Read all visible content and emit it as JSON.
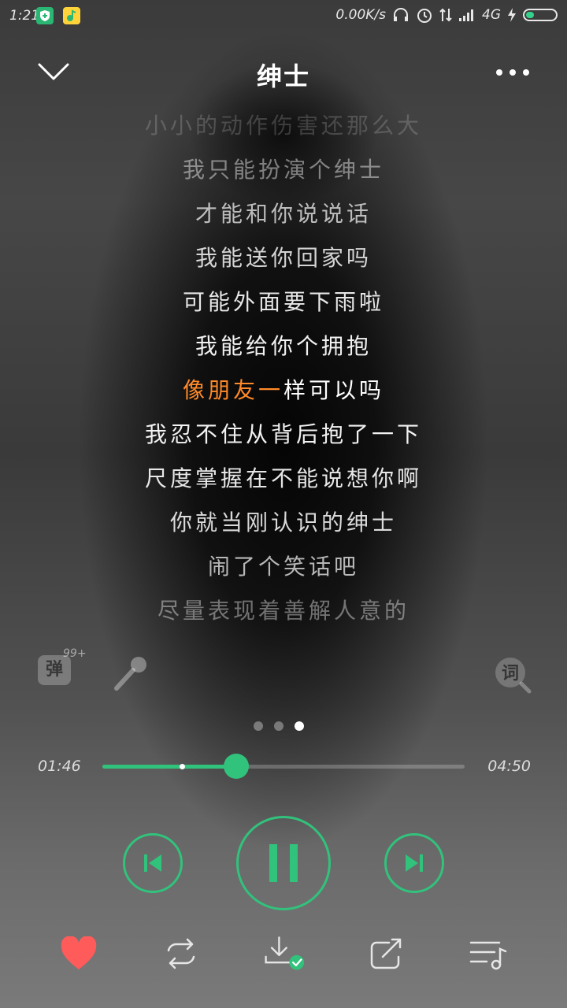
{
  "status_bar": {
    "time": "1:21",
    "network_speed": "0.00K/s",
    "network_type": "4G",
    "icons": [
      "shield-app-icon",
      "qq-music-app-icon",
      "headset-icon",
      "alarm-icon",
      "data-arrows-icon",
      "signal-icon",
      "charging-icon",
      "battery-icon"
    ]
  },
  "header": {
    "title": "绅士",
    "back_icon": "chevron-down-icon",
    "more_icon": "more-dots-icon"
  },
  "lyrics": {
    "lines": [
      "小小的动作伤害还那么大",
      "我只能扮演个绅士",
      "才能和你说说话",
      "我能送你回家吗",
      "可能外面要下雨啦",
      "我能给你个拥抱",
      "像朋友一样可以吗",
      "我忍不住从背后抱了一下",
      "尺度掌握在不能说想你啊",
      "你就当刚认识的绅士",
      "闹了个笑话吧",
      "尽量表现着善解人意的"
    ],
    "current_index": 6,
    "current_sung": "像朋友一",
    "current_rest": "样可以吗"
  },
  "tools": {
    "danmu_label": "弹",
    "danmu_count": "99+",
    "ci_label": "词"
  },
  "pager": {
    "count": 3,
    "active": 2
  },
  "progress": {
    "current": "01:46",
    "total": "04:50",
    "played_fraction": 0.37,
    "buffered_fraction": 0.22
  },
  "colors": {
    "accent": "#31c27c",
    "lyric_sung": "#ff8a2a",
    "heart": "#ff5b5b"
  },
  "bottom_bar": {
    "items": [
      "heart-icon",
      "repeat-icon",
      "download-done-icon",
      "share-icon",
      "playlist-icon"
    ],
    "favorited": true
  }
}
